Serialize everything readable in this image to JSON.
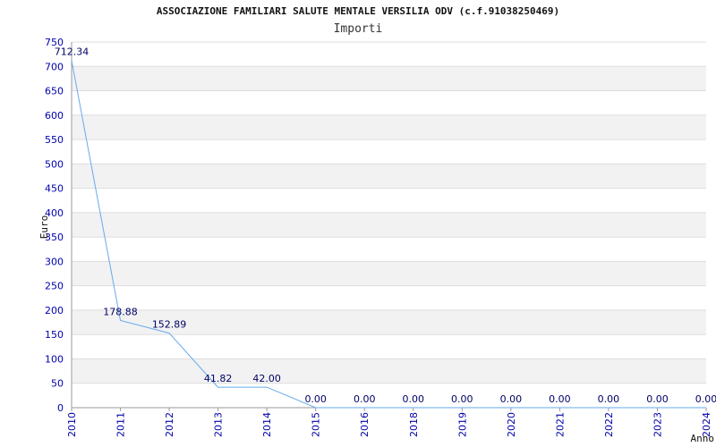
{
  "header": {
    "title": "ASSOCIAZIONE FAMILIARI SALUTE MENTALE VERSILIA ODV (c.f.91038250469)"
  },
  "chart_data": {
    "type": "line",
    "title": "Importi",
    "ylabel": "Euro",
    "xlabel": "Anno",
    "ylim": [
      0,
      750
    ],
    "yticks": [
      "0",
      "50",
      "100",
      "150",
      "200",
      "250",
      "300",
      "350",
      "400",
      "450",
      "500",
      "550",
      "600",
      "650",
      "700",
      "750"
    ],
    "categories": [
      "2010",
      "2011",
      "2012",
      "2013",
      "2014",
      "2015",
      "2016",
      "2018",
      "2019",
      "2020",
      "2021",
      "2022",
      "2023",
      "2024"
    ],
    "values": [
      712.34,
      178.88,
      152.89,
      41.82,
      42.0,
      0,
      0,
      0,
      0,
      0,
      0,
      0,
      0,
      0
    ],
    "value_labels": [
      "712.34",
      "178.88",
      "152.89",
      "41.82",
      "42.00",
      "0.00",
      "0.00",
      "0.00",
      "0.00",
      "0.00",
      "0.00",
      "0.00",
      "0.00",
      "0.00"
    ],
    "grid": true,
    "colors": {
      "line": "#66aaee",
      "band": "#f2f2f2",
      "grid": "#dddddd",
      "tick_text": "#0000aa",
      "data_label": "#000066"
    }
  }
}
